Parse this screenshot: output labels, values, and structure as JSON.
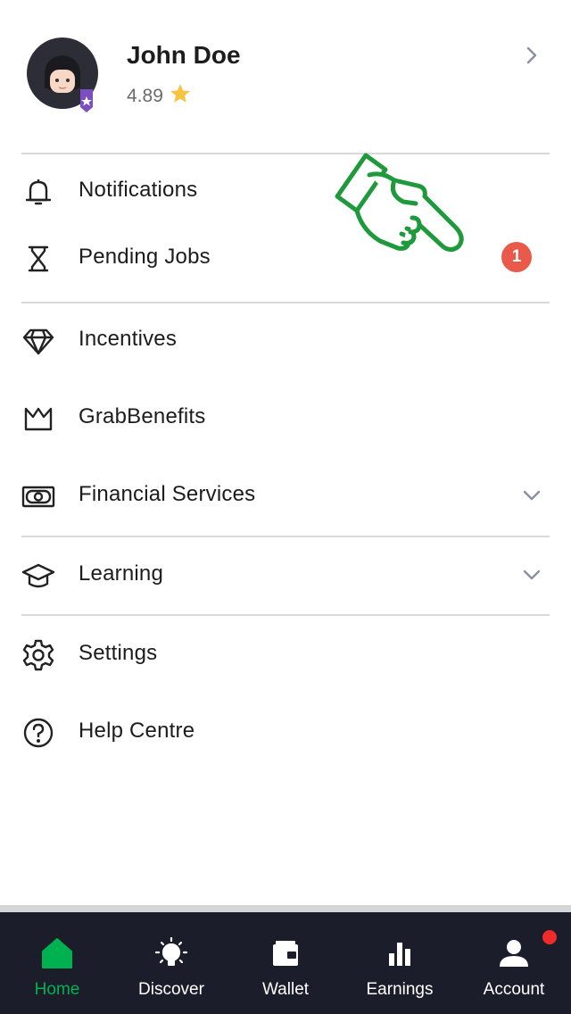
{
  "profile": {
    "name": "John Doe",
    "rating": "4.89",
    "rating_icon": "star-icon",
    "star_color": "#f5c542",
    "badge_color": "#7b4fc0"
  },
  "menu": {
    "notifications": {
      "label": "Notifications",
      "icon": "bell-icon"
    },
    "pending_jobs": {
      "label": "Pending Jobs",
      "icon": "hourglass-icon",
      "badge": "1"
    },
    "incentives": {
      "label": "Incentives",
      "icon": "diamond-icon"
    },
    "grab_benefits": {
      "label": "GrabBenefits",
      "icon": "crown-icon"
    },
    "financial_services": {
      "label": "Financial Services",
      "icon": "banknote-icon"
    },
    "learning": {
      "label": "Learning",
      "icon": "graduation-cap-icon"
    },
    "settings": {
      "label": "Settings",
      "icon": "gear-icon"
    },
    "help_centre": {
      "label": "Help Centre",
      "icon": "question-circle-icon"
    }
  },
  "bottom_nav": {
    "home": "Home",
    "discover": "Discover",
    "wallet": "Wallet",
    "earnings": "Earnings",
    "account": "Account"
  },
  "colors": {
    "accent_green": "#00b14f",
    "badge_red": "#ea5a4a",
    "nav_background": "#1b1d2b",
    "pointer_green": "#1e9a3c"
  }
}
